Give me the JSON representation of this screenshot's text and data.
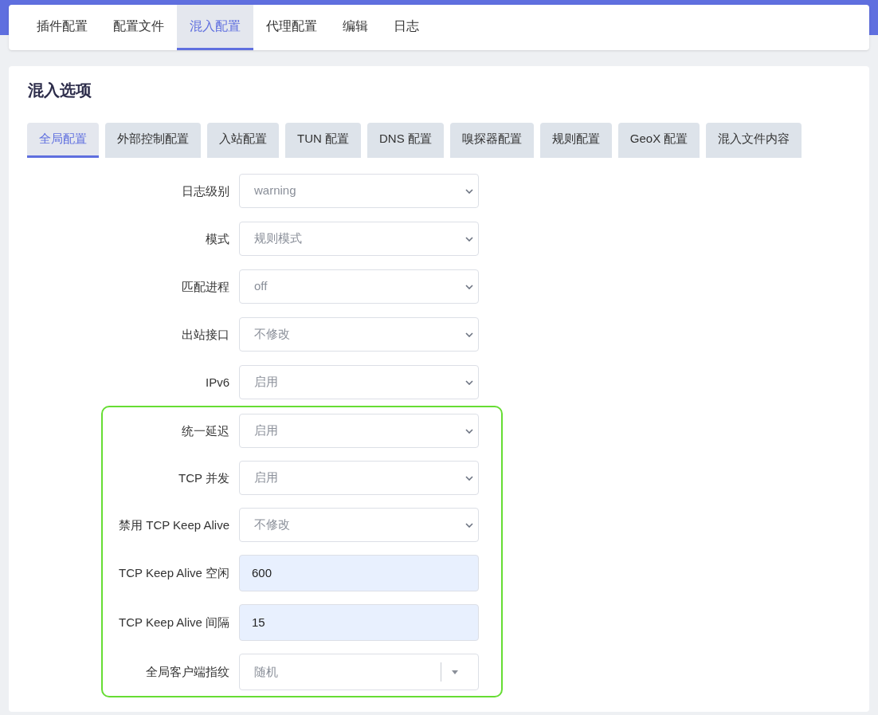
{
  "nav_tabs": [
    {
      "label": "插件配置",
      "selected": false
    },
    {
      "label": "配置文件",
      "selected": false
    },
    {
      "label": "混入配置",
      "selected": true
    },
    {
      "label": "代理配置",
      "selected": false
    },
    {
      "label": "编辑",
      "selected": false
    },
    {
      "label": "日志",
      "selected": false
    }
  ],
  "section_title": "混入选项",
  "sub_tabs": [
    {
      "label": "全局配置",
      "selected": true
    },
    {
      "label": "外部控制配置",
      "selected": false
    },
    {
      "label": "入站配置",
      "selected": false
    },
    {
      "label": "TUN 配置",
      "selected": false
    },
    {
      "label": "DNS 配置",
      "selected": false
    },
    {
      "label": "嗅探器配置",
      "selected": false
    },
    {
      "label": "规则配置",
      "selected": false
    },
    {
      "label": "GeoX 配置",
      "selected": false
    },
    {
      "label": "混入文件内容",
      "selected": false
    }
  ],
  "fields": [
    {
      "label": "日志级别",
      "kind": "select",
      "value": "warning"
    },
    {
      "label": "模式",
      "kind": "select",
      "value": "规则模式"
    },
    {
      "label": "匹配进程",
      "kind": "select",
      "value": "off"
    },
    {
      "label": "出站接口",
      "kind": "select",
      "value": "不修改"
    },
    {
      "label": "IPv6",
      "kind": "select",
      "value": "启用"
    }
  ],
  "highlighted_fields": [
    {
      "label": "统一延迟",
      "kind": "select",
      "value": "启用"
    },
    {
      "label": "TCP 并发",
      "kind": "select",
      "value": "启用"
    },
    {
      "label": "禁用 TCP Keep Alive",
      "kind": "select",
      "value": "不修改"
    },
    {
      "label": "TCP Keep Alive 空闲",
      "kind": "input",
      "value": "600"
    },
    {
      "label": "TCP Keep Alive 间隔",
      "kind": "input",
      "value": "15"
    },
    {
      "label": "全局客户端指纹",
      "kind": "combo",
      "value": "随机"
    }
  ]
}
